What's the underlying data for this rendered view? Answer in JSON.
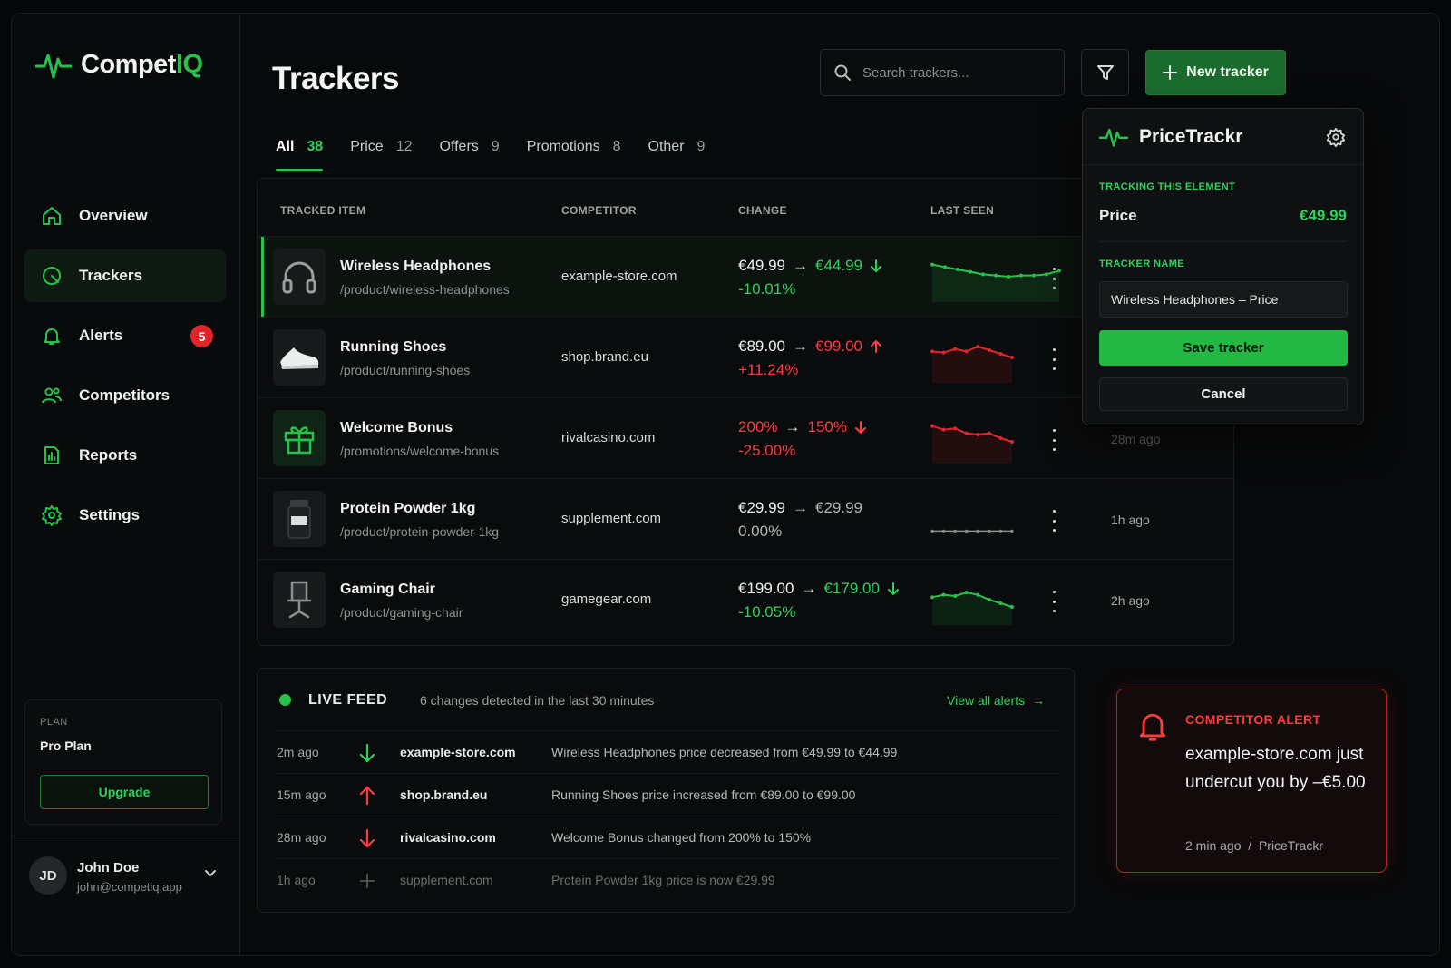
{
  "app": {
    "name_part1": "Compet",
    "name_part2": "IQ"
  },
  "colors": {
    "accent": "#27c24a",
    "danger": "#ff3b3b",
    "background": "#08090a"
  },
  "sidebar": {
    "items": [
      {
        "label": "Overview",
        "icon": "home-icon"
      },
      {
        "label": "Trackers",
        "icon": "radar-icon",
        "active": true
      },
      {
        "label": "Alerts",
        "icon": "bell-icon",
        "badge": "5"
      },
      {
        "label": "Competitors",
        "icon": "users-icon"
      },
      {
        "label": "Reports",
        "icon": "report-icon"
      },
      {
        "label": "Settings",
        "icon": "gear-icon"
      }
    ],
    "plan": {
      "label": "PLAN",
      "name": "Pro Plan",
      "upgrade": "Upgrade"
    },
    "user": {
      "initials": "JD",
      "name": "John Doe",
      "email": "john@competiq.app"
    }
  },
  "header": {
    "title": "Trackers",
    "search_placeholder": "Search trackers...",
    "new_tracker": "New tracker"
  },
  "tabs": [
    {
      "label": "All",
      "count": "38",
      "active": true
    },
    {
      "label": "Price",
      "count": "12"
    },
    {
      "label": "Offers",
      "count": "9"
    },
    {
      "label": "Promotions",
      "count": "8"
    },
    {
      "label": "Other",
      "count": "9"
    }
  ],
  "table": {
    "columns": [
      "TRACKED ITEM",
      "COMPETITOR",
      "CHANGE",
      "LAST SEEN"
    ],
    "rows": [
      {
        "name": "Wireless Headphones",
        "path": "/product/wireless-headphones",
        "competitor": "example-store.com",
        "from": "€49.99",
        "to": "€44.99",
        "pct": "-10.01%",
        "direction": "down",
        "last_seen": "",
        "thumb": "headphones-icon",
        "spark": [
          50,
          48,
          46,
          44,
          42,
          41,
          40,
          41,
          41,
          42,
          45
        ]
      },
      {
        "name": "Running Shoes",
        "path": "/product/running-shoes",
        "competitor": "shop.brand.eu",
        "from": "€89.00",
        "to": "€99.00",
        "pct": "+11.24%",
        "direction": "up",
        "last_seen": "",
        "thumb": "shoe-icon",
        "spark": [
          45,
          44,
          47,
          45,
          49,
          46,
          43,
          40
        ]
      },
      {
        "name": "Welcome Bonus",
        "path": "/promotions/welcome-bonus",
        "competitor": "rivalcasino.com",
        "from": "200%",
        "to": "150%",
        "pct": "-25.00%",
        "direction": "down-red",
        "last_seen": "28m ago",
        "thumb": "gift-icon",
        "spark": [
          50,
          47,
          48,
          44,
          43,
          44,
          40,
          37
        ]
      },
      {
        "name": "Protein Powder 1kg",
        "path": "/product/protein-powder-1kg",
        "competitor": "supplement.com",
        "from": "€29.99",
        "to": "€29.99",
        "pct": "0.00%",
        "direction": "flat",
        "last_seen": "1h ago",
        "thumb": "jar-icon",
        "spark": [
          30,
          30,
          30,
          30,
          30,
          30,
          30,
          30
        ]
      },
      {
        "name": "Gaming Chair",
        "path": "/product/gaming-chair",
        "competitor": "gamegear.com",
        "from": "€199.00",
        "to": "€179.00",
        "pct": "-10.05%",
        "direction": "down",
        "last_seen": "2h ago",
        "thumb": "chair-icon",
        "spark": [
          42,
          44,
          43,
          46,
          44,
          40,
          37,
          34
        ]
      }
    ]
  },
  "feed": {
    "title": "LIVE FEED",
    "subtitle": "6 changes detected in the last 30 minutes",
    "view_all": "View all alerts",
    "items": [
      {
        "time": "2m ago",
        "site": "example-store.com",
        "message": "Wireless Headphones price decreased from €49.99 to €44.99",
        "icon": "arrow-down-icon"
      },
      {
        "time": "15m ago",
        "site": "shop.brand.eu",
        "message": "Running Shoes price increased from €89.00 to €99.00",
        "icon": "arrow-up-icon"
      },
      {
        "time": "28m ago",
        "site": "rivalcasino.com",
        "message": "Welcome Bonus changed from 200% to 150%",
        "icon": "arrow-down-icon"
      },
      {
        "time": "1h ago",
        "site": "supplement.com",
        "message": "Protein Powder 1kg price is now €29.99",
        "icon": "plus-icon"
      }
    ]
  },
  "popup": {
    "name": "PriceTrackr",
    "tracking_label": "TRACKING THIS ELEMENT",
    "field": "Price",
    "value": "€49.99",
    "name_label": "TRACKER NAME",
    "tracker_name": "Wireless Headphones – Price",
    "save": "Save tracker",
    "cancel": "Cancel"
  },
  "alert": {
    "title": "COMPETITOR ALERT",
    "message": "example-store.com just undercut you by –€5.00",
    "time": "2 min ago",
    "separator": "/",
    "source": "PriceTrackr"
  }
}
